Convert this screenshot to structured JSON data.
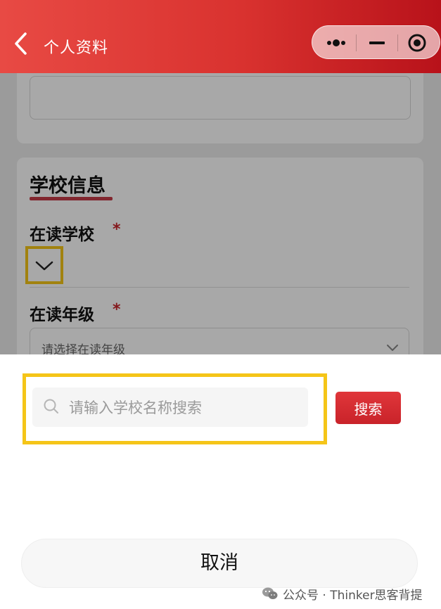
{
  "header": {
    "title": "个人资料",
    "colors": {
      "start": "#e84a44",
      "end": "#b8121a"
    }
  },
  "capsule": {
    "more_icon": "more-dots-icon",
    "minimize_icon": "minimize-icon",
    "close_icon": "target-circle-icon"
  },
  "page": {
    "school_section": {
      "title": "学校信息",
      "school_label": "在读学校",
      "school_required": "*",
      "grade_label": "在读年级",
      "grade_required": "*",
      "grade_placeholder": "请选择在读年级"
    }
  },
  "sheet": {
    "search": {
      "placeholder": "请输入学校名称搜索",
      "value": "",
      "button_label": "搜索"
    },
    "cancel_label": "取消"
  },
  "watermark": {
    "text": "公众号 · Thinker思客背提"
  },
  "colors": {
    "accent": "#d9322f",
    "highlight": "#f5c518",
    "required": "#c9252b"
  }
}
